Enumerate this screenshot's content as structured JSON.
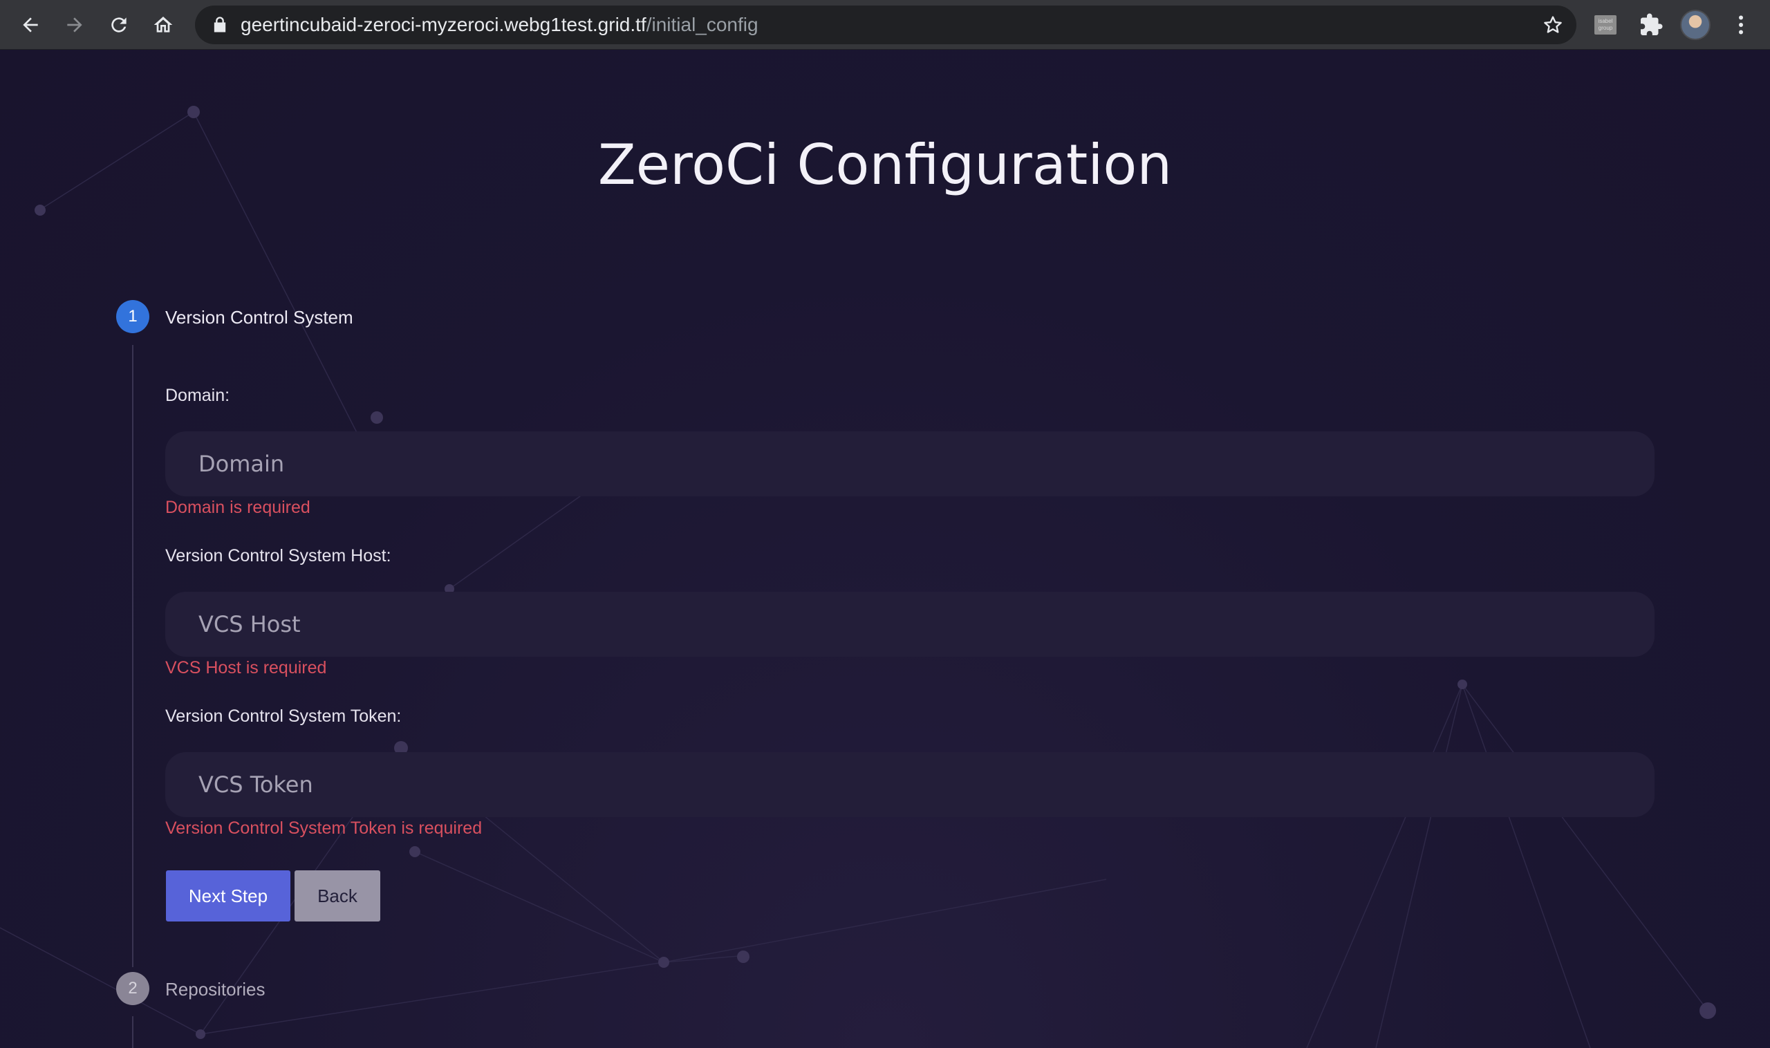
{
  "browser": {
    "url_host": "geertincubaid-zeroci-myzeroci.webg1test.grid.tf",
    "url_path": "/initial_config",
    "extension_label": "isabel group",
    "nav_icons": [
      "back-arrow-icon",
      "forward-arrow-icon",
      "reload-icon",
      "home-icon"
    ],
    "toolbar_icons": [
      "lock-icon",
      "star-icon",
      "extension-icon",
      "puzzle-icon",
      "avatar",
      "kebab-menu-icon"
    ]
  },
  "page": {
    "title": "ZeroCi Configuration"
  },
  "steps": [
    {
      "number": "1",
      "label": "Version Control System",
      "state": "active"
    },
    {
      "number": "2",
      "label": "Repositories",
      "state": "inactive"
    }
  ],
  "form": {
    "fields": [
      {
        "label": "Domain:",
        "placeholder": "Domain",
        "value": "",
        "error": "Domain is required"
      },
      {
        "label": "Version Control System Host:",
        "placeholder": "VCS Host",
        "value": "",
        "error": "VCS Host is required"
      },
      {
        "label": "Version Control System Token:",
        "placeholder": "VCS Token",
        "value": "",
        "error": "Version Control System Token is required"
      }
    ],
    "next_label": "Next Step",
    "back_label": "Back"
  },
  "colors": {
    "background": "#1b1631",
    "accent_step": "#3273dc",
    "primary_button": "#5763d9",
    "secondary_button": "#9894a6",
    "error": "#d9505f"
  }
}
